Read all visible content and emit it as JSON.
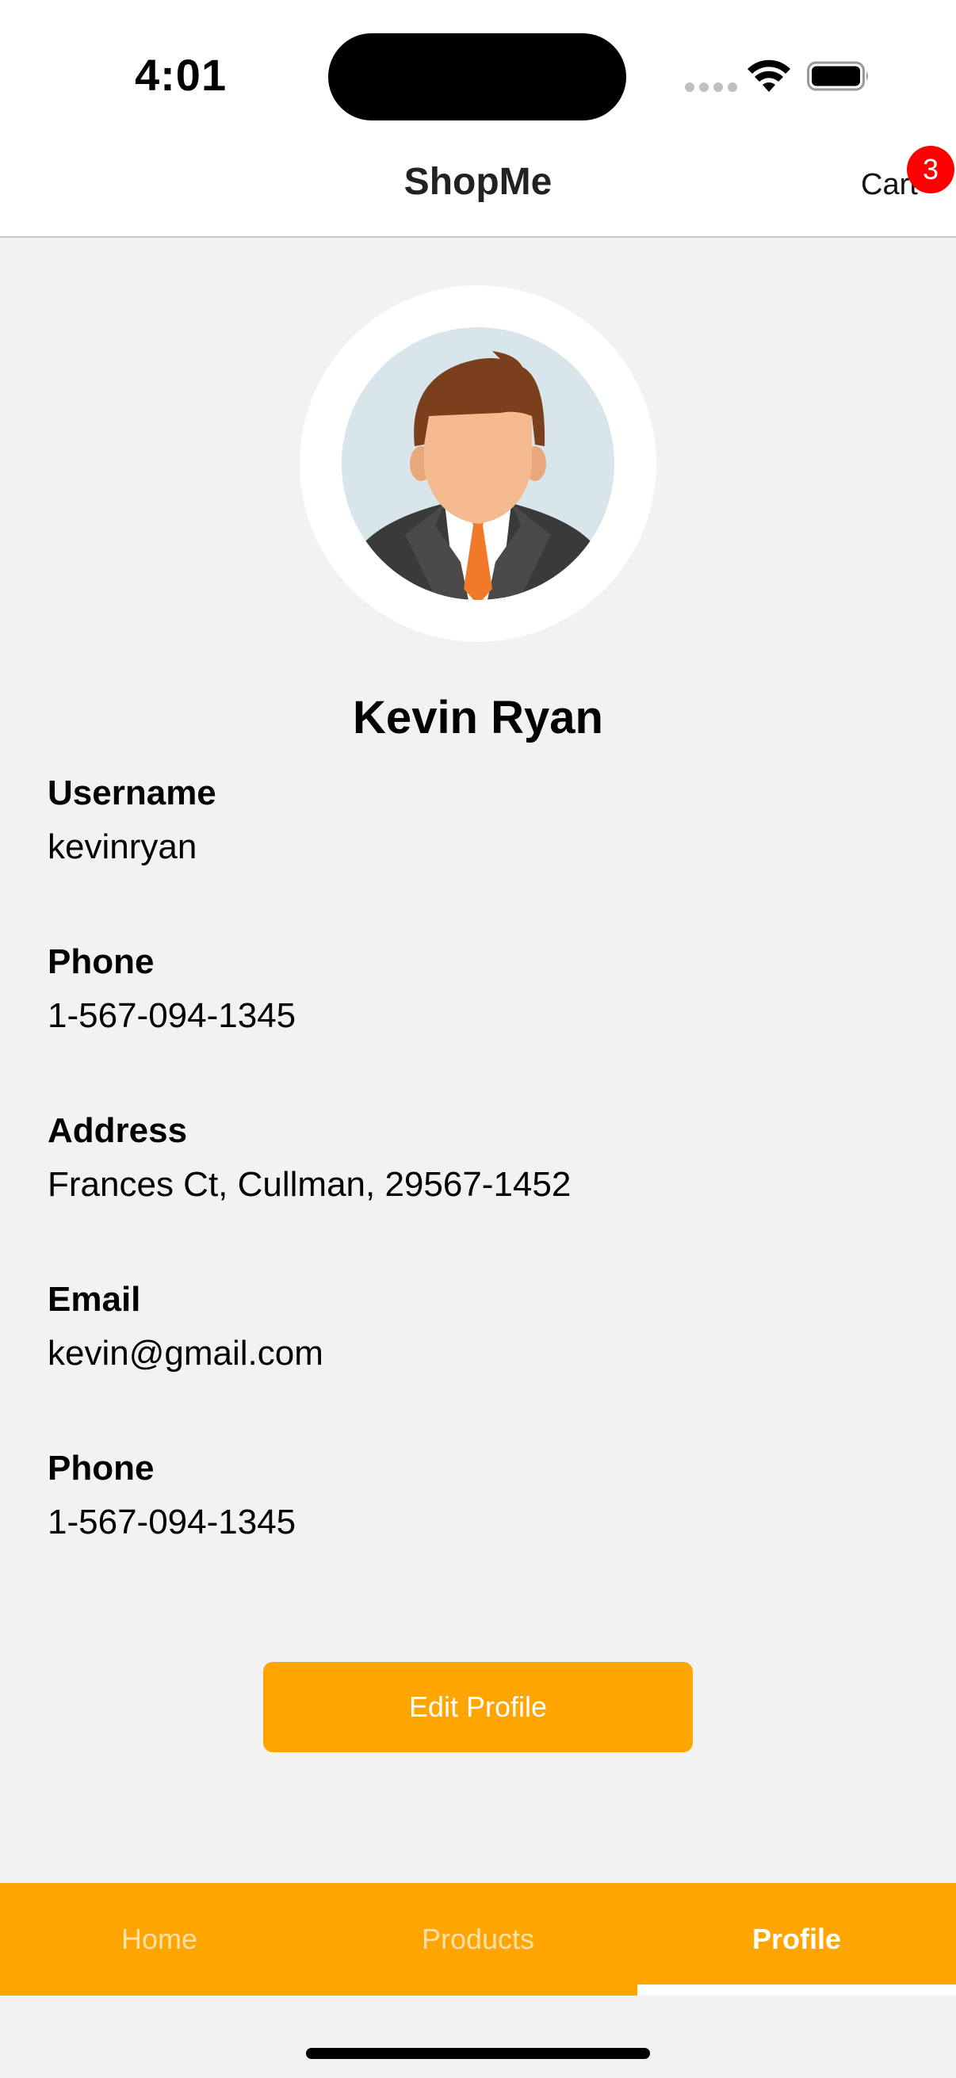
{
  "status_bar": {
    "time": "4:01"
  },
  "header": {
    "title": "ShopMe",
    "cart_label": "Cart",
    "cart_count": "3"
  },
  "profile": {
    "name": "Kevin Ryan",
    "fields": [
      {
        "label": "Username",
        "value": "kevinryan"
      },
      {
        "label": "Phone",
        "value": "1-567-094-1345"
      },
      {
        "label": "Address",
        "value": "Frances Ct, Cullman, 29567-1452"
      },
      {
        "label": "Email",
        "value": "kevin@gmail.com"
      },
      {
        "label": "Phone",
        "value": "1-567-094-1345"
      }
    ],
    "edit_button_label": "Edit Profile"
  },
  "tabs": [
    {
      "label": "Home",
      "active": false
    },
    {
      "label": "Products",
      "active": false
    },
    {
      "label": "Profile",
      "active": true
    }
  ],
  "colors": {
    "accent": "#ffa500",
    "badge": "#ff0000",
    "background": "#f2f2f2"
  }
}
